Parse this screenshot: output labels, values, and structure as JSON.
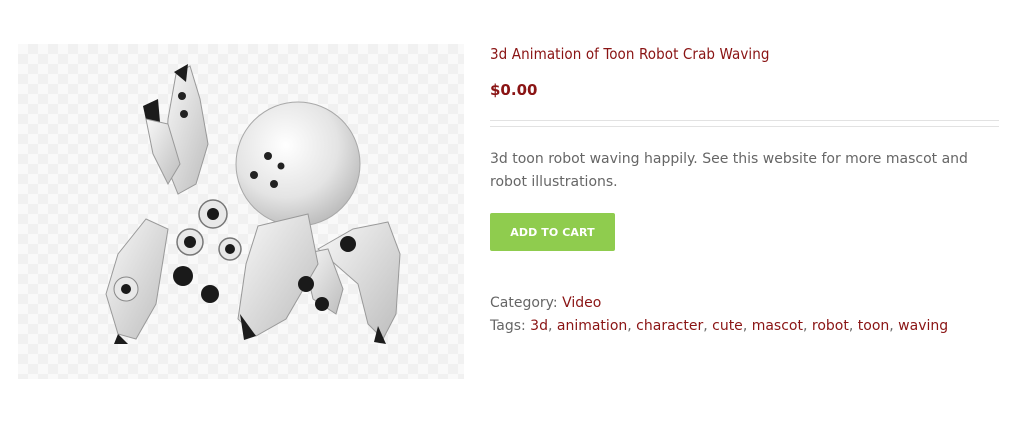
{
  "product": {
    "image_icon": "robot-crab-illustration",
    "title": "3d Animation of Toon Robot Crab Waving",
    "price": "$0.00",
    "description": "3d toon robot waving happily. See this website for more mascot and robot illustrations.",
    "add_to_cart_label": "ADD TO CART"
  },
  "meta": {
    "category_label": "Category:",
    "category": "Video",
    "tags_label": "Tags:",
    "tags": [
      "3d",
      "animation",
      "character",
      "cute",
      "mascot",
      "robot",
      "toon",
      "waving"
    ],
    "separator": ", "
  },
  "colors": {
    "accent": "#8a1414",
    "button": "#8fcc4e",
    "text": "#666666"
  }
}
